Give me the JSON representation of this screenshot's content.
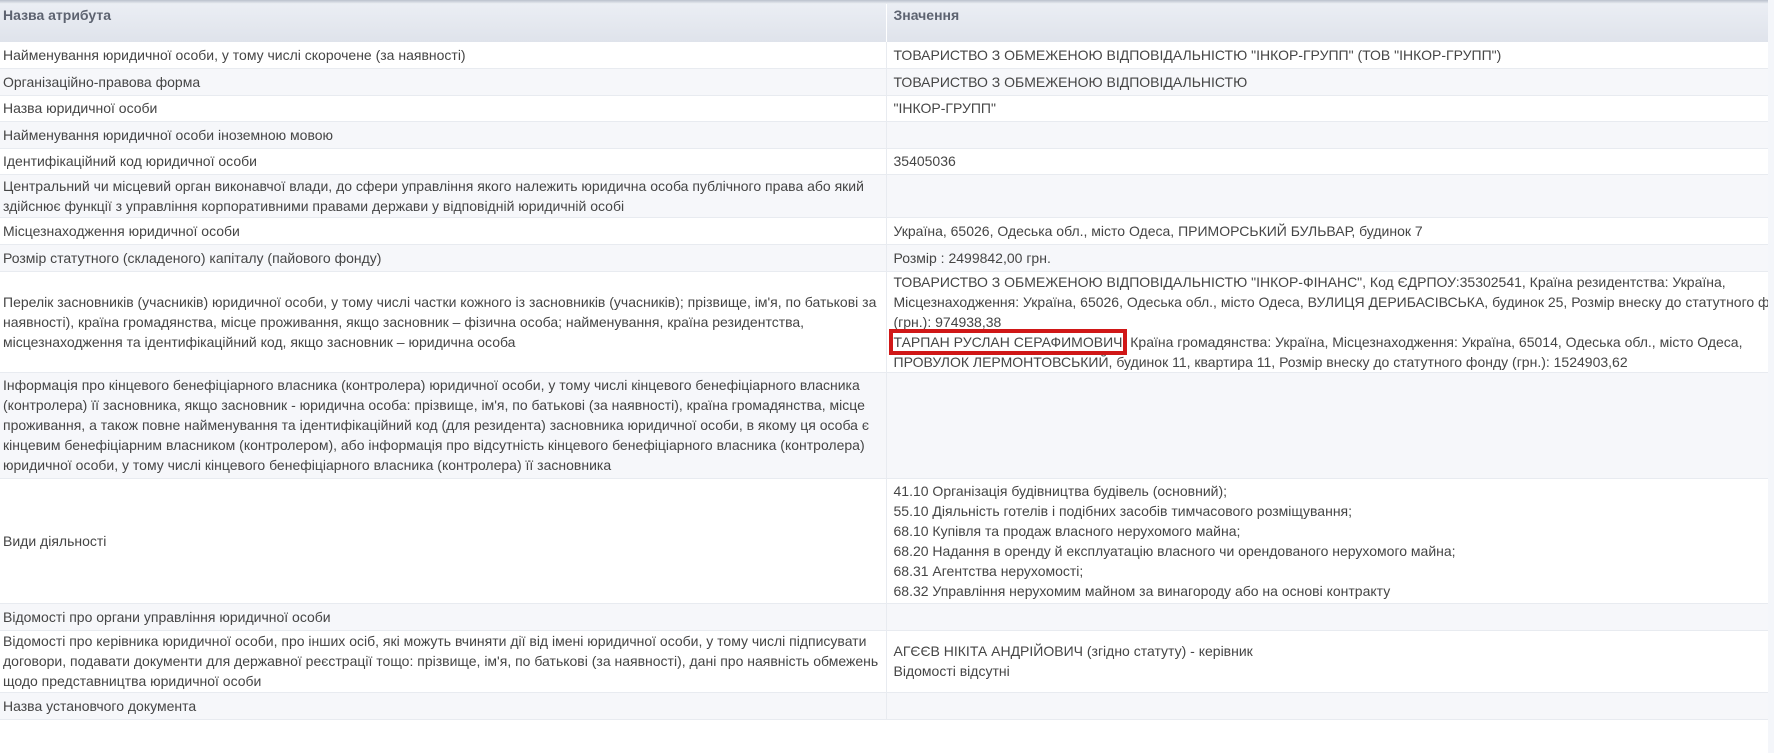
{
  "header": {
    "col_attribute": "Назва атрибута",
    "col_value": "Значення"
  },
  "rows": [
    {
      "attr": "Найменування юридичної особи, у тому числі скорочене (за наявності)",
      "value": "ТОВАРИСТВО З ОБМЕЖЕНОЮ ВІДПОВІДАЛЬНІСТЮ \"ІНКОР-ГРУПП\" (ТОВ \"ІНКОР-ГРУПП\")"
    },
    {
      "attr": "Організаційно-правова форма",
      "value": "ТОВАРИСТВО З ОБМЕЖЕНОЮ ВІДПОВІДАЛЬНІСТЮ"
    },
    {
      "attr": "Назва юридичної особи",
      "value": "\"ІНКОР-ГРУПП\""
    },
    {
      "attr": "Найменування юридичної особи іноземною мовою",
      "value": ""
    },
    {
      "attr": "Ідентифікаційний код юридичної особи",
      "value": "35405036"
    },
    {
      "attr_lines": [
        "Центральний чи місцевий орган виконавчої влади, до сфери управління якого належить юридична особа публічного права або який",
        "здійснює функції з управління корпоративними правами держави у відповідній юридичній особі"
      ],
      "value": ""
    },
    {
      "attr": "Місцезнаходження юридичної особи",
      "value": "Україна, 65026, Одеська обл., місто Одеса, ПРИМОРСЬКИЙ БУЛЬВАР, будинок 7"
    },
    {
      "attr": "Розмір статутного (складеного) капіталу (пайового фонду)",
      "value": "Розмір : 2499842,00 грн."
    },
    {
      "attr_lines": [
        "Перелік засновників (учасників) юридичної особи, у тому числі частки кожного із засновників (учасників); прізвище, ім'я, по батькові за",
        "наявності), країна громадянства, місце проживання, якщо засновник – фізична особа; найменування, країна резидентства,",
        "місцезнаходження та ідентифікаційний код, якщо засновник – юридична особа"
      ],
      "founder1_lines": [
        "ТОВАРИСТВО З ОБМЕЖЕНОЮ ВІДПОВІДАЛЬНІСТЮ \"ІНКОР-ФІНАНС\", Код ЄДРПОУ:35302541, Країна резидентства: Україна,",
        "Місцезнаходження: Україна, 65026, Одеська обл., місто Одеса, ВУЛИЦЯ ДЕРИБАСІВСЬКА, будинок 25, Розмір внеску до статутного фонду",
        "(грн.): 974938,38"
      ],
      "founder2_name": "ТАРПАН РУСЛАН СЕРАФИМОВИЧ",
      "founder2_rest1": ", Країна громадянства: Україна, Місцезнаходження: Україна, 65014, Одеська обл., місто Одеса,",
      "founder2_rest2": "ПРОВУЛОК ЛЕРМОНТОВСЬКИЙ, будинок 11, квартира 11, Розмір внеску до статутного фонду (грн.): 1524903,62"
    },
    {
      "attr_lines": [
        "Інформація про кінцевого бенефіціарного власника (контролера) юридичної особи, у тому числі кінцевого бенефіціарного власника",
        "(контролера) її засновника, якщо засновник - юридична особа: прізвище, ім'я, по батькові (за наявності), країна громадянства, місце",
        "проживання, а також повне найменування та ідентифікаційний код (для резидента) засновника юридичної особи, в якому ця особа є",
        "кінцевим бенефіціарним власником (контролером), або інформація про відсутність кінцевого бенефіціарного власника (контролера)",
        "юридичної особи, у тому числі кінцевого бенефіціарного власника (контролера) її засновника"
      ],
      "value": ""
    },
    {
      "attr": "Види діяльності",
      "value_lines": [
        "41.10 Організація будівництва будівель (основний);",
        "55.10 Діяльність готелів і подібних засобів тимчасового розміщування;",
        "68.10 Купівля та продаж власного нерухомого майна;",
        "68.20 Надання в оренду й експлуатацію власного чи орендованого нерухомого майна;",
        "68.31 Агентства нерухомості;",
        "68.32 Управління нерухомим майном за винагороду або на основі контракту"
      ]
    },
    {
      "attr": "Відомості про органи управління юридичної особи",
      "value": ""
    },
    {
      "attr_lines": [
        "Відомості про керівника юридичної особи, про інших осіб, які можуть вчиняти дії від імені юридичної особи, у тому числі підписувати",
        "договори, подавати документи для державної реєстрації тощо: прізвище, ім'я, по батькові (за наявності), дані про наявність обмежень",
        "щодо представництва юридичної особи"
      ],
      "value_lines": [
        "АГЄЄВ НІКІТА АНДРІЙОВИЧ (згідно статуту) - керівник",
        "Відомості відсутні"
      ]
    },
    {
      "attr": "Назва установчого документа",
      "value": ""
    }
  ]
}
